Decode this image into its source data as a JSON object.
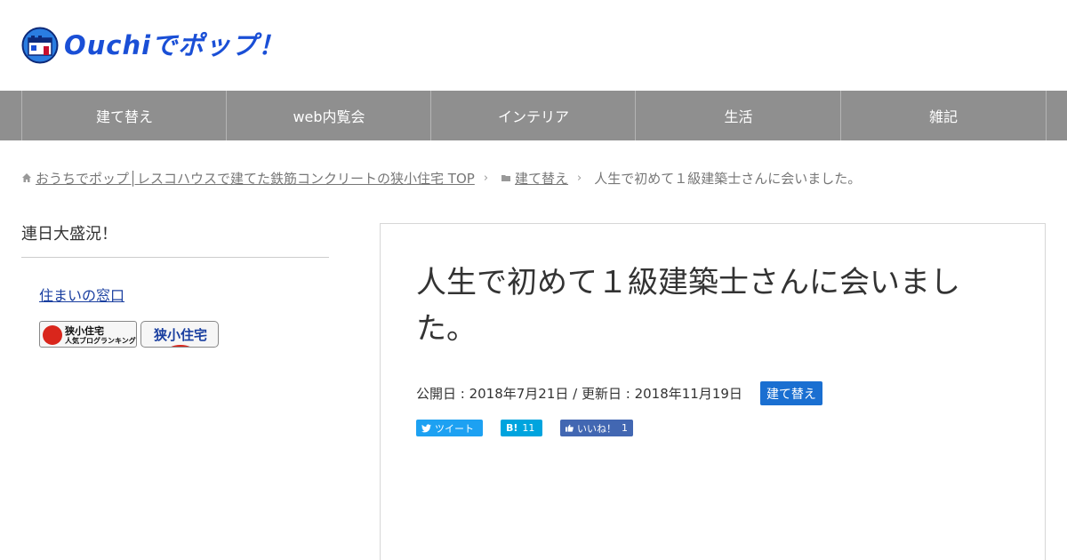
{
  "site": {
    "logo_text": "Ouchiでポップ！",
    "colors": {
      "brand_blue": "#1a4fd6",
      "nav_bg": "#8f8f8f",
      "category_blue": "#1a6fd1"
    }
  },
  "nav": {
    "items": [
      {
        "label": "建て替え"
      },
      {
        "label": "web内覧会"
      },
      {
        "label": "インテリア"
      },
      {
        "label": "生活"
      },
      {
        "label": "雑記"
      }
    ]
  },
  "breadcrumb": {
    "home_icon": "home-icon",
    "home_label": "おうちでポップ│レスコハウスで建てた鉄筋コンクリートの狭小住宅 TOP",
    "category_icon": "folder-icon",
    "category_label": "建て替え",
    "current": "人生で初めて１級建築士さんに会いました。"
  },
  "sidebar": {
    "widget_title": "連日大盛況！",
    "link_label": "住まいの窓口",
    "banner1_line1": "狭小住宅",
    "banner1_line2": "人気ブログランキング",
    "banner2_label": "狭小住宅"
  },
  "article": {
    "title": "人生で初めて１級建築士さんに会いました。",
    "meta": "公開日 : 2018年7月21日 / 更新日 : 2018年11月19日",
    "category_badge": "建て替え",
    "share": {
      "tweet_label": "ツイート",
      "hatena_label": "B!",
      "hatena_count": "11",
      "like_label": "いいね！",
      "like_count": "1"
    }
  }
}
